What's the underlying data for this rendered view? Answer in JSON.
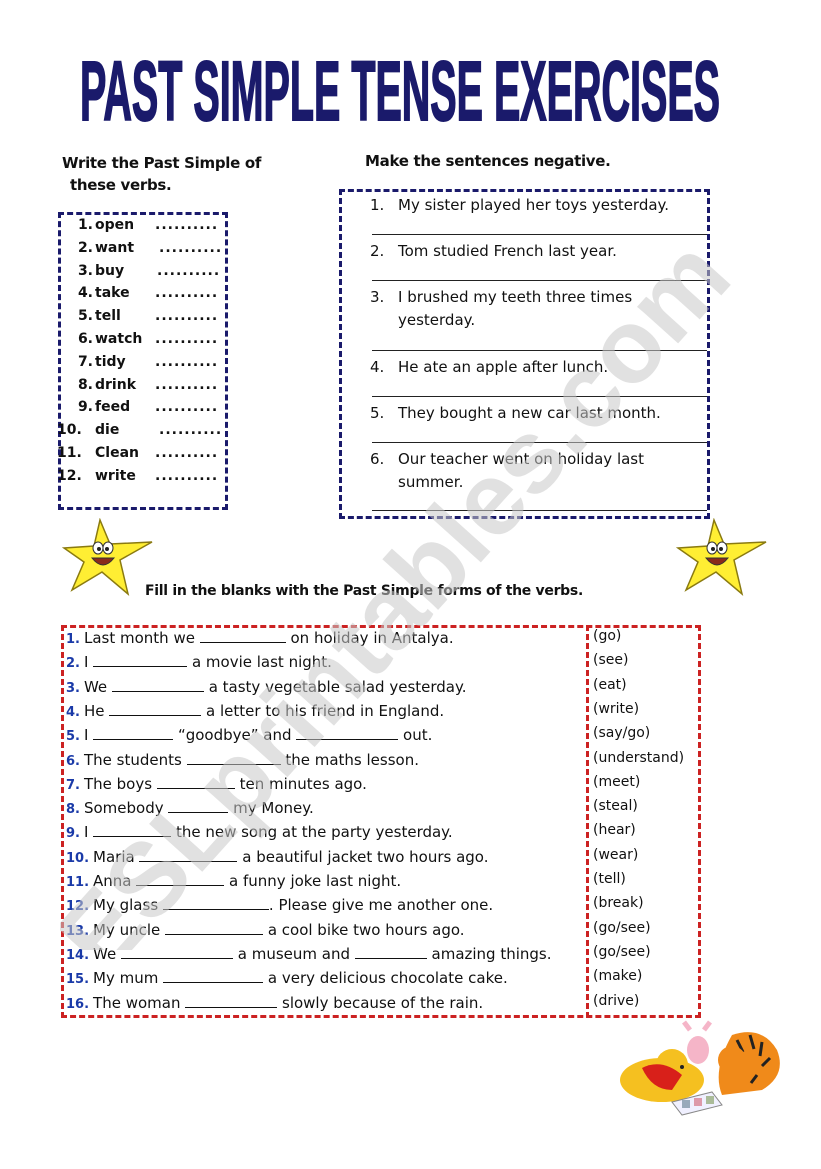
{
  "title": "PAST SIMPLE TENSE EXERCISES",
  "colors": {
    "title": "#1a1a6b",
    "blue_border": "#1a1a6b",
    "red_border": "#cc2222",
    "number_blue": "#1a3aa8",
    "star_yellow": "#ffee33",
    "watermark": "#c8c8c8"
  },
  "exercise1": {
    "instruction_line1": "Write the Past Simple of",
    "instruction_line2": "these verbs.",
    "answer_placeholder": "..........",
    "verbs": [
      {
        "num": "1.",
        "verb": "open"
      },
      {
        "num": "2.",
        "verb": "want"
      },
      {
        "num": "3.",
        "verb": "buy"
      },
      {
        "num": "4.",
        "verb": "take"
      },
      {
        "num": "5.",
        "verb": "tell"
      },
      {
        "num": "6.",
        "verb": "watch"
      },
      {
        "num": "7.",
        "verb": "tidy"
      },
      {
        "num": "8.",
        "verb": "drink"
      },
      {
        "num": "9.",
        "verb": "feed"
      },
      {
        "num": "10.",
        "verb": "die"
      },
      {
        "num": "11.",
        "verb": "Clean"
      },
      {
        "num": "12.",
        "verb": "write"
      }
    ]
  },
  "exercise2": {
    "instruction": "Make the sentences negative.",
    "sentences": [
      {
        "num": "1.",
        "text": "My sister played her toys yesterday."
      },
      {
        "num": "2.",
        "text": "Tom studied French last year."
      },
      {
        "num": "3.",
        "text": "I brushed my teeth three times yesterday."
      },
      {
        "num": "4.",
        "text": "He ate an apple after lunch."
      },
      {
        "num": "5.",
        "text": "They bought a new car last month."
      },
      {
        "num": "6.",
        "text": "Our teacher went on holiday last summer."
      }
    ]
  },
  "exercise3": {
    "instruction": "Fill in the blanks with the Past Simple forms of the verbs.",
    "items": [
      {
        "num": "1.",
        "parts": [
          "Last month we ",
          " on holiday in Antalya."
        ],
        "hint": "(go)"
      },
      {
        "num": "2.",
        "parts": [
          "I ",
          " a movie last night."
        ],
        "hint": "(see)"
      },
      {
        "num": "3.",
        "parts": [
          "We ",
          " a tasty vegetable salad yesterday."
        ],
        "hint": "(eat)"
      },
      {
        "num": "4.",
        "parts": [
          "He ",
          " a letter to his friend in England."
        ],
        "hint": "(write)"
      },
      {
        "num": "5.",
        "parts": [
          "I ",
          " “goodbye” and ",
          " out."
        ],
        "hint": "(say/go)"
      },
      {
        "num": "6.",
        "parts": [
          "The students ",
          " the maths lesson."
        ],
        "hint": "(understand)"
      },
      {
        "num": "7.",
        "parts": [
          "The boys ",
          " ten minutes ago."
        ],
        "hint": "(meet)"
      },
      {
        "num": "8.",
        "parts": [
          "Somebody ",
          " my Money."
        ],
        "hint": "(steal)"
      },
      {
        "num": "9.",
        "parts": [
          "I ",
          " the new song at the party yesterday."
        ],
        "hint": "(hear)"
      },
      {
        "num": "10.",
        "parts": [
          "Maria ",
          " a beautiful jacket two hours ago."
        ],
        "hint": "(wear)"
      },
      {
        "num": "11.",
        "parts": [
          "Anna ",
          " a funny joke last night."
        ],
        "hint": "(tell)"
      },
      {
        "num": "12.",
        "parts": [
          "My glass ",
          ". Please give me another one."
        ],
        "hint": "(break)"
      },
      {
        "num": "13.",
        "parts": [
          "My uncle ",
          " a cool bike two hours ago."
        ],
        "hint": "(go/see)"
      },
      {
        "num": "14.",
        "parts": [
          "We ",
          " a museum and ",
          " amazing things."
        ],
        "hint": "(go/see)"
      },
      {
        "num": "15.",
        "parts": [
          "My mum ",
          " a very delicious chocolate cake."
        ],
        "hint": "(make)"
      },
      {
        "num": "16.",
        "parts": [
          "The woman ",
          " slowly because of the rain."
        ],
        "hint": "(drive)"
      }
    ]
  },
  "watermark": "ESLprintables.com",
  "decorations": {
    "left_star": "smiling-star",
    "right_star": "smiling-star",
    "bottom_image": "pooh-piglet-tigger-reading"
  }
}
